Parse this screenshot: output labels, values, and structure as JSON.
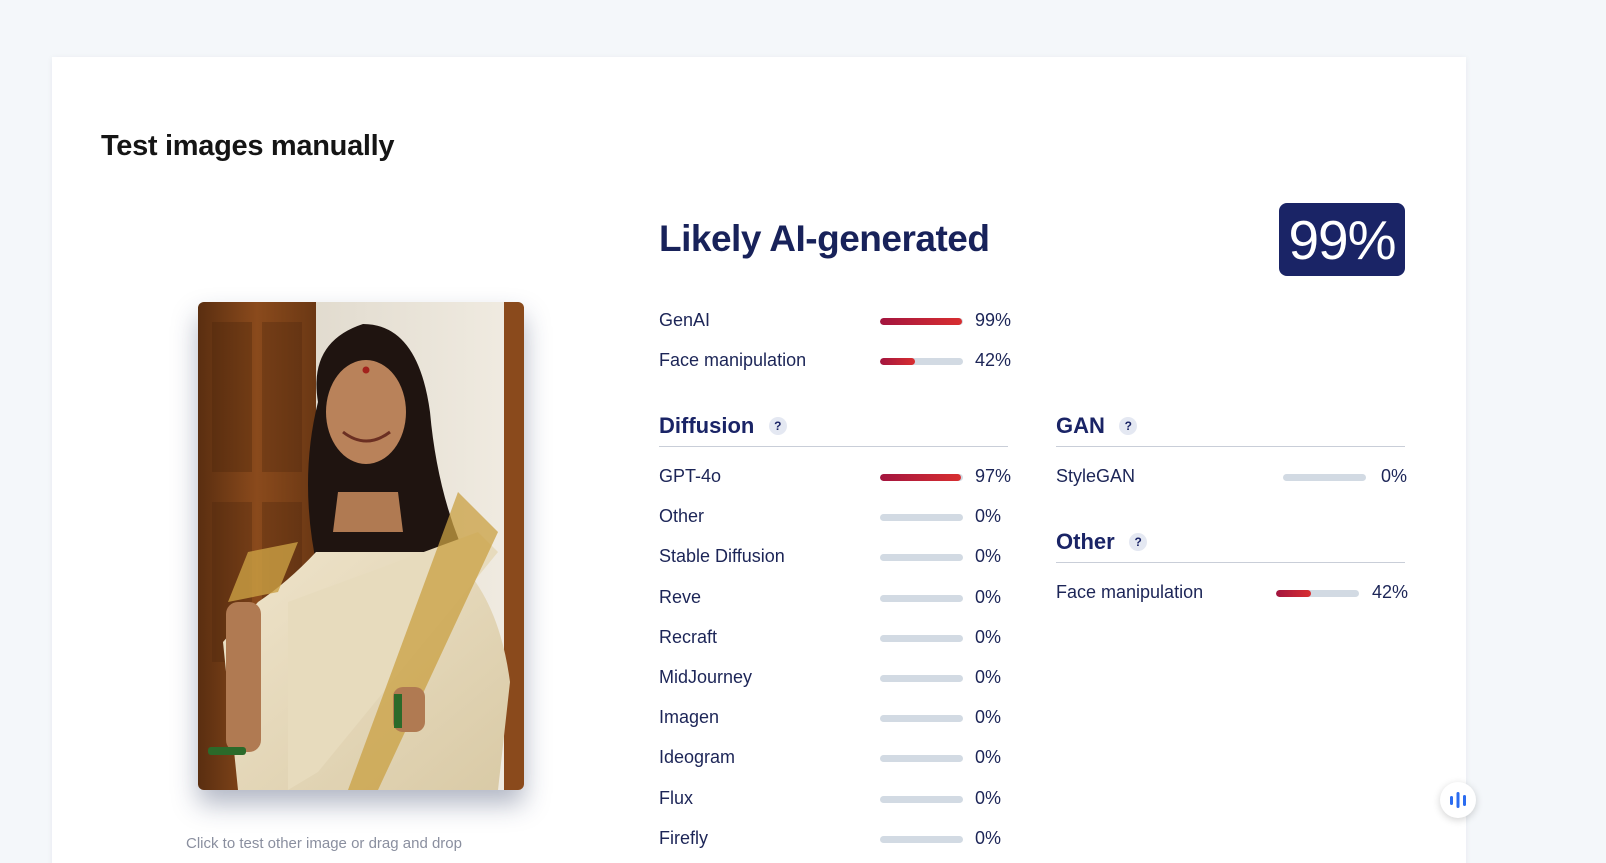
{
  "page": {
    "title": "Test images manually",
    "caption": "Click to test other image or drag and drop"
  },
  "result": {
    "verdict": "Likely AI-generated",
    "score": "99%"
  },
  "summary": [
    {
      "label": "GenAI",
      "value": 0.99,
      "pct": "99%"
    },
    {
      "label": "Face manipulation",
      "value": 0.42,
      "pct": "42%"
    }
  ],
  "diffusion": {
    "title": "Diffusion",
    "help": "?",
    "items": [
      {
        "label": "GPT-4o",
        "value": 0.97,
        "pct": "97%"
      },
      {
        "label": "Other",
        "value": 0,
        "pct": "0%"
      },
      {
        "label": "Stable Diffusion",
        "value": 0,
        "pct": "0%"
      },
      {
        "label": "Reve",
        "value": 0,
        "pct": "0%"
      },
      {
        "label": "Recraft",
        "value": 0,
        "pct": "0%"
      },
      {
        "label": "MidJourney",
        "value": 0,
        "pct": "0%"
      },
      {
        "label": "Imagen",
        "value": 0,
        "pct": "0%"
      },
      {
        "label": "Ideogram",
        "value": 0,
        "pct": "0%"
      },
      {
        "label": "Flux",
        "value": 0,
        "pct": "0%"
      },
      {
        "label": "Firefly",
        "value": 0,
        "pct": "0%"
      }
    ]
  },
  "gan": {
    "title": "GAN",
    "help": "?",
    "items": [
      {
        "label": "StyleGAN",
        "value": 0,
        "pct": "0%"
      }
    ]
  },
  "other": {
    "title": "Other",
    "help": "?",
    "items": [
      {
        "label": "Face manipulation",
        "value": 0.42,
        "pct": "42%"
      }
    ]
  },
  "icons": {
    "help": "question-icon",
    "fab": "audio-bars-icon"
  },
  "colors": {
    "accent": "#1a2466",
    "bar_fill_start": "#a3153f",
    "bar_fill_end": "#d82e30",
    "bar_track": "#d2dae3"
  }
}
